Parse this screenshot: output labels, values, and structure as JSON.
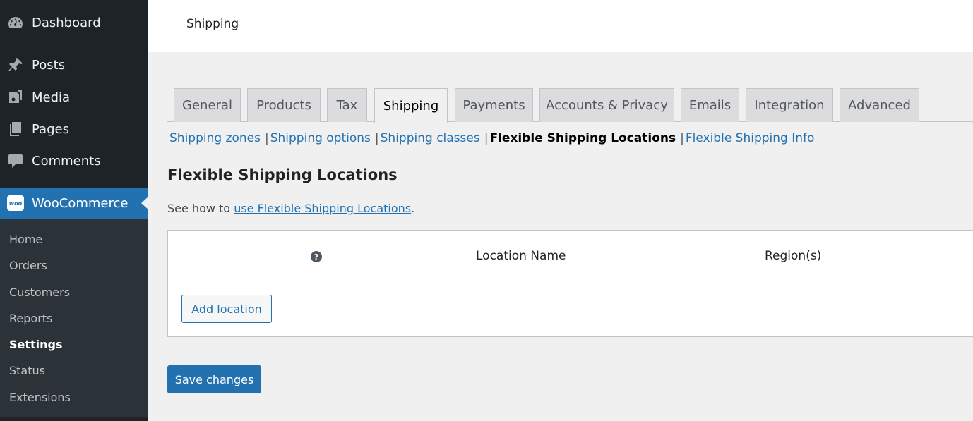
{
  "sidebar": {
    "menu": [
      {
        "label": "Dashboard",
        "icon": "dashboard-icon"
      },
      {
        "label": "Posts",
        "icon": "pin-icon"
      },
      {
        "label": "Media",
        "icon": "media-icon"
      },
      {
        "label": "Pages",
        "icon": "pages-icon"
      },
      {
        "label": "Comments",
        "icon": "comment-icon"
      },
      {
        "label": "WooCommerce",
        "icon": "woocommerce-icon",
        "logo_text": "woo"
      }
    ],
    "submenu": [
      "Home",
      "Orders",
      "Customers",
      "Reports",
      "Settings",
      "Status",
      "Extensions"
    ],
    "current_submenu": "Settings"
  },
  "header": {
    "title": "Shipping"
  },
  "tabs": [
    "General",
    "Products",
    "Tax",
    "Shipping",
    "Payments",
    "Accounts & Privacy",
    "Emails",
    "Integration",
    "Advanced"
  ],
  "active_tab": "Shipping",
  "subnav": {
    "items": [
      "Shipping zones",
      "Shipping options",
      "Shipping classes",
      "Flexible Shipping Locations",
      "Flexible Shipping Info"
    ],
    "separator": "|",
    "current": "Flexible Shipping Locations"
  },
  "section": {
    "title": "Flexible Shipping Locations",
    "help_prefix": "See how to ",
    "help_link": "use Flexible Shipping Locations",
    "help_suffix": "."
  },
  "table": {
    "help_tip": "?",
    "columns": [
      "Location Name",
      "Region(s)"
    ],
    "add_button": "Add location"
  },
  "save_button": "Save changes",
  "colors": {
    "sidebar_bg": "#1d2327",
    "submenu_bg": "#2c3338",
    "accent": "#2271b1",
    "page_bg": "#f0f0f1"
  }
}
